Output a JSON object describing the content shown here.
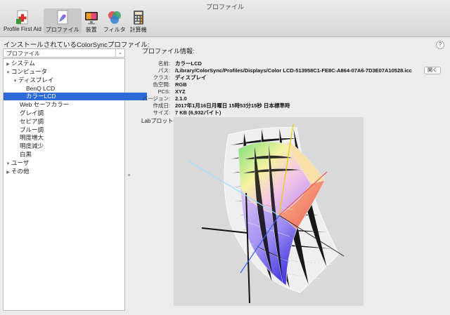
{
  "window": {
    "title": "プロファイル"
  },
  "toolbar": {
    "items": [
      {
        "label": "Profile First Aid",
        "icon": "profile-first-aid-icon",
        "selected": false
      },
      {
        "label": "プロファイル",
        "icon": "profile-document-icon",
        "selected": true
      },
      {
        "label": "装置",
        "icon": "display-device-icon",
        "selected": false
      },
      {
        "label": "フィルタ",
        "icon": "color-filter-icon",
        "selected": false
      },
      {
        "label": "計算機",
        "icon": "calculator-icon",
        "selected": false
      }
    ]
  },
  "sidebar": {
    "heading": "インストールされているColorSyncプロファイル:",
    "filter_value": "プロファイル",
    "tree": [
      {
        "label": "システム",
        "level": 0,
        "disclosure": "collapsed",
        "selected": false
      },
      {
        "label": "コンピュータ",
        "level": 0,
        "disclosure": "expanded",
        "selected": false
      },
      {
        "label": "ディスプレイ",
        "level": 1,
        "disclosure": "expanded",
        "selected": false
      },
      {
        "label": "BenQ LCD",
        "level": 2,
        "disclosure": "none",
        "selected": false
      },
      {
        "label": "カラーLCD",
        "level": 2,
        "disclosure": "none",
        "selected": true
      },
      {
        "label": "Web セーフカラー",
        "level": 1,
        "disclosure": "none",
        "selected": false
      },
      {
        "label": "グレイ調",
        "level": 1,
        "disclosure": "none",
        "selected": false
      },
      {
        "label": "セピア調",
        "level": 1,
        "disclosure": "none",
        "selected": false
      },
      {
        "label": "ブルー調",
        "level": 1,
        "disclosure": "none",
        "selected": false
      },
      {
        "label": "明度増大",
        "level": 1,
        "disclosure": "none",
        "selected": false
      },
      {
        "label": "明度減少",
        "level": 1,
        "disclosure": "none",
        "selected": false
      },
      {
        "label": "白黒",
        "level": 1,
        "disclosure": "none",
        "selected": false
      },
      {
        "label": "ユーザ",
        "level": 0,
        "disclosure": "collapsed",
        "selected": false
      },
      {
        "label": "その他",
        "level": 0,
        "disclosure": "collapsed",
        "selected": false
      }
    ]
  },
  "info": {
    "heading": "プロファイル情報:",
    "open_button": "開く",
    "rows": [
      {
        "label": "名前:",
        "value": "カラーLCD"
      },
      {
        "label": "パス:",
        "value": "/Library/ColorSync/Profiles/Displays/Color LCD-513958C1-FE8C-A864-07A6-7D3E07A10528.icc"
      },
      {
        "label": "クラス:",
        "value": "ディスプレイ"
      },
      {
        "label": "色空間:",
        "value": "RGB"
      },
      {
        "label": "PCS:",
        "value": "XYZ"
      },
      {
        "label": "バージョン:",
        "value": "2.1.0"
      },
      {
        "label": "作成日:",
        "value": "2017年1月16日月曜日 15時53分15秒 日本標準時"
      },
      {
        "label": "サイズ:",
        "value": "7 KB (6,932バイト)"
      }
    ]
  },
  "lab_plot": {
    "label": "Labプロット:",
    "menu_icon": "triangle-down-icon",
    "background": "#d9d9d9"
  },
  "colors": {
    "selection": "#2c6ad6",
    "toolbar_selected": "#c9c9c9"
  }
}
